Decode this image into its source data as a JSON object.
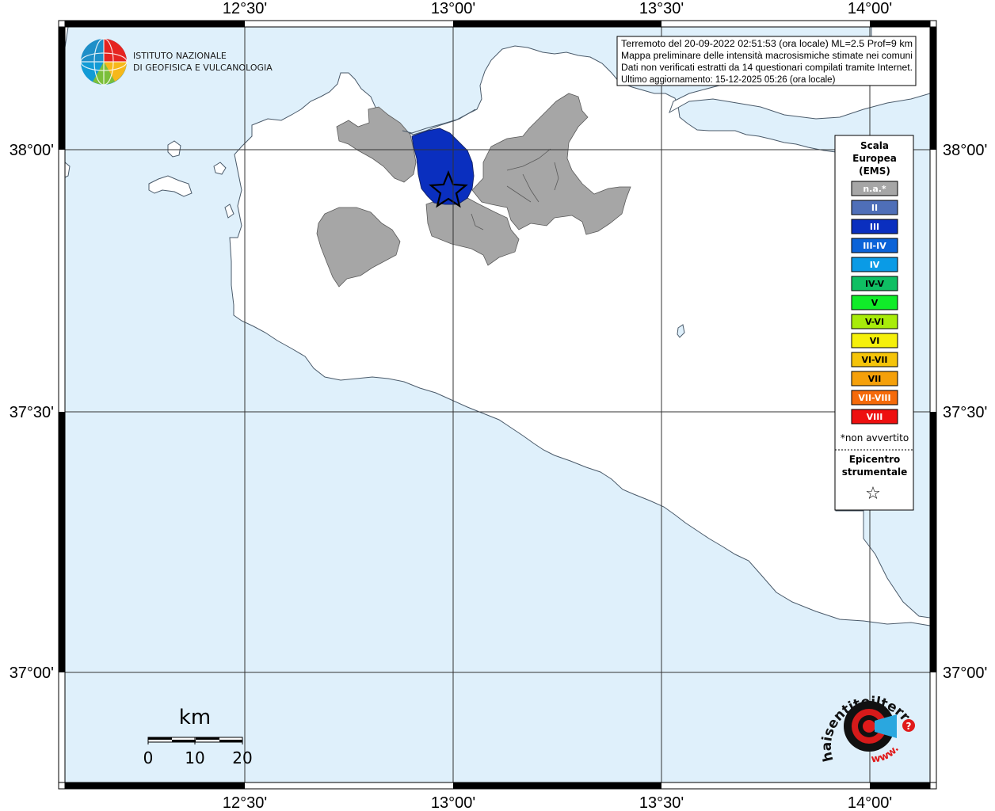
{
  "logo": {
    "line1": "ISTITUTO NAZIONALE",
    "line2": "DI GEOFISICA E VULCANOLOGIA"
  },
  "info": {
    "line1": "Terremoto del 20-09-2022 02:51:53 (ora locale) ML=2.5 Prof=9 km",
    "line2": "Mappa preliminare delle intensità macrosismiche stimate nei comuni",
    "line3": "Dati non verificati estratti da 14 questionari compilati tramite Internet.",
    "line4": "Ultimo aggiornamento: 15-12-2025 05:26 (ora locale)"
  },
  "axes": {
    "lon_ticks": [
      "12°30'",
      "13°00'",
      "13°30'",
      "14°00'"
    ],
    "lat_ticks": [
      "38°00'",
      "37°30'",
      "37°00'"
    ]
  },
  "legend": {
    "title1": "Scala",
    "title2": "Europea",
    "title3": "(EMS)",
    "items": [
      {
        "label": "n.a.*",
        "color": "#a6a6a6"
      },
      {
        "label": "II",
        "color": "#4f6fb8"
      },
      {
        "label": "III",
        "color": "#0a2fbf"
      },
      {
        "label": "III-IV",
        "color": "#0b63d8"
      },
      {
        "label": "IV",
        "color": "#0a9be6"
      },
      {
        "label": "IV-V",
        "color": "#0fbf63"
      },
      {
        "label": "V",
        "color": "#10ec29"
      },
      {
        "label": "V-VI",
        "color": "#a8ec0a"
      },
      {
        "label": "VI",
        "color": "#f5f00a"
      },
      {
        "label": "VI-VII",
        "color": "#f5c40a"
      },
      {
        "label": "VII",
        "color": "#f5a00a"
      },
      {
        "label": "VII-VIII",
        "color": "#f56a0a"
      },
      {
        "label": "VIII",
        "color": "#ee1010"
      }
    ],
    "note": "*non avvertito",
    "epicenter1": "Epicentro",
    "epicenter2": "strumentale",
    "epicenter_symbol": "☆"
  },
  "scalebar": {
    "unit": "km",
    "labels": [
      "0",
      "10",
      "20"
    ]
  },
  "watermark": {
    "text": "haisentitoilterremoto.it",
    "text2": "www."
  },
  "colors": {
    "sea": "#dff0fb",
    "land": "#ffffff",
    "coast": "#4a5a6a",
    "municipality_na": "#a6a6a6",
    "municipality_iii": "#0a2fbf",
    "frame": "#000000"
  }
}
